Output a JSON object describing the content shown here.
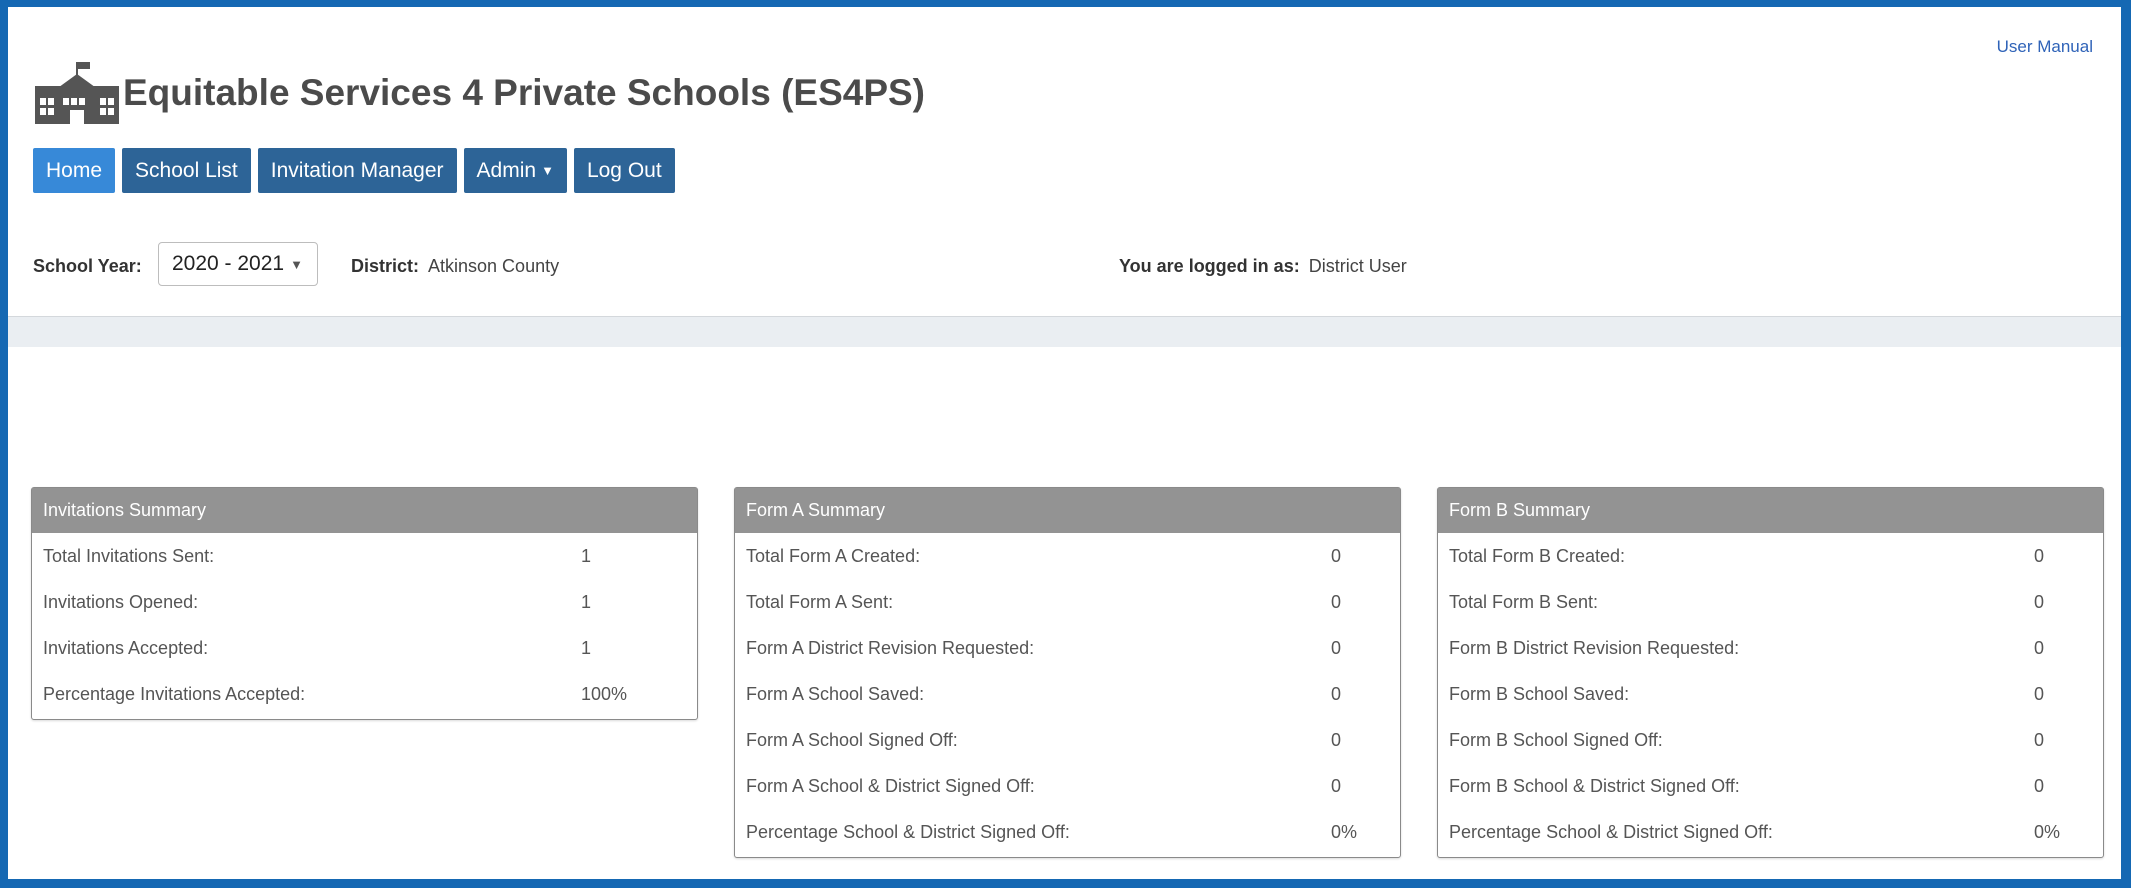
{
  "links": {
    "user_manual": "User Manual"
  },
  "app": {
    "title": "Equitable Services 4 Private Schools (ES4PS)"
  },
  "nav": {
    "home": "Home",
    "school_list": "School List",
    "invitation_manager": "Invitation Manager",
    "admin": "Admin",
    "log_out": "Log Out"
  },
  "filters": {
    "school_year_label": "School Year:",
    "school_year_value": "2020 - 2021",
    "district_label": "District:",
    "district_value": "Atkinson County",
    "logged_in_label": "You are logged in as:",
    "logged_in_value": "District User"
  },
  "invitations": {
    "title": "Invitations Summary",
    "rows": [
      {
        "label": "Total Invitations Sent:",
        "value": "1"
      },
      {
        "label": "Invitations Opened:",
        "value": "1"
      },
      {
        "label": "Invitations Accepted:",
        "value": "1"
      },
      {
        "label": "Percentage Invitations Accepted:",
        "value": "100%"
      }
    ]
  },
  "form_a": {
    "title": "Form A Summary",
    "rows": [
      {
        "label": "Total Form A Created:",
        "value": "0"
      },
      {
        "label": "Total Form A Sent:",
        "value": "0"
      },
      {
        "label": "Form A District Revision Requested:",
        "value": "0"
      },
      {
        "label": "Form A School Saved:",
        "value": "0"
      },
      {
        "label": "Form A School Signed Off:",
        "value": "0"
      },
      {
        "label": "Form A School & District Signed Off:",
        "value": "0"
      },
      {
        "label": "Percentage School & District Signed Off:",
        "value": "0%"
      }
    ]
  },
  "form_b": {
    "title": "Form B Summary",
    "rows": [
      {
        "label": "Total Form B Created:",
        "value": "0"
      },
      {
        "label": "Total Form B Sent:",
        "value": "0"
      },
      {
        "label": "Form B District Revision Requested:",
        "value": "0"
      },
      {
        "label": "Form B School Saved:",
        "value": "0"
      },
      {
        "label": "Form B School Signed Off:",
        "value": "0"
      },
      {
        "label": "Form B School & District Signed Off:",
        "value": "0"
      },
      {
        "label": "Percentage School & District Signed Off:",
        "value": "0%"
      }
    ]
  },
  "colors": {
    "frame": "#1568b3",
    "nav_button": "#2d6497",
    "nav_active": "#3789d8",
    "panel_header": "#939393",
    "link": "#2f63b8"
  },
  "icons": {
    "logo": "school-building-icon",
    "admin_caret": "caret-down-icon",
    "select_arrow": "triangle-down-icon"
  }
}
